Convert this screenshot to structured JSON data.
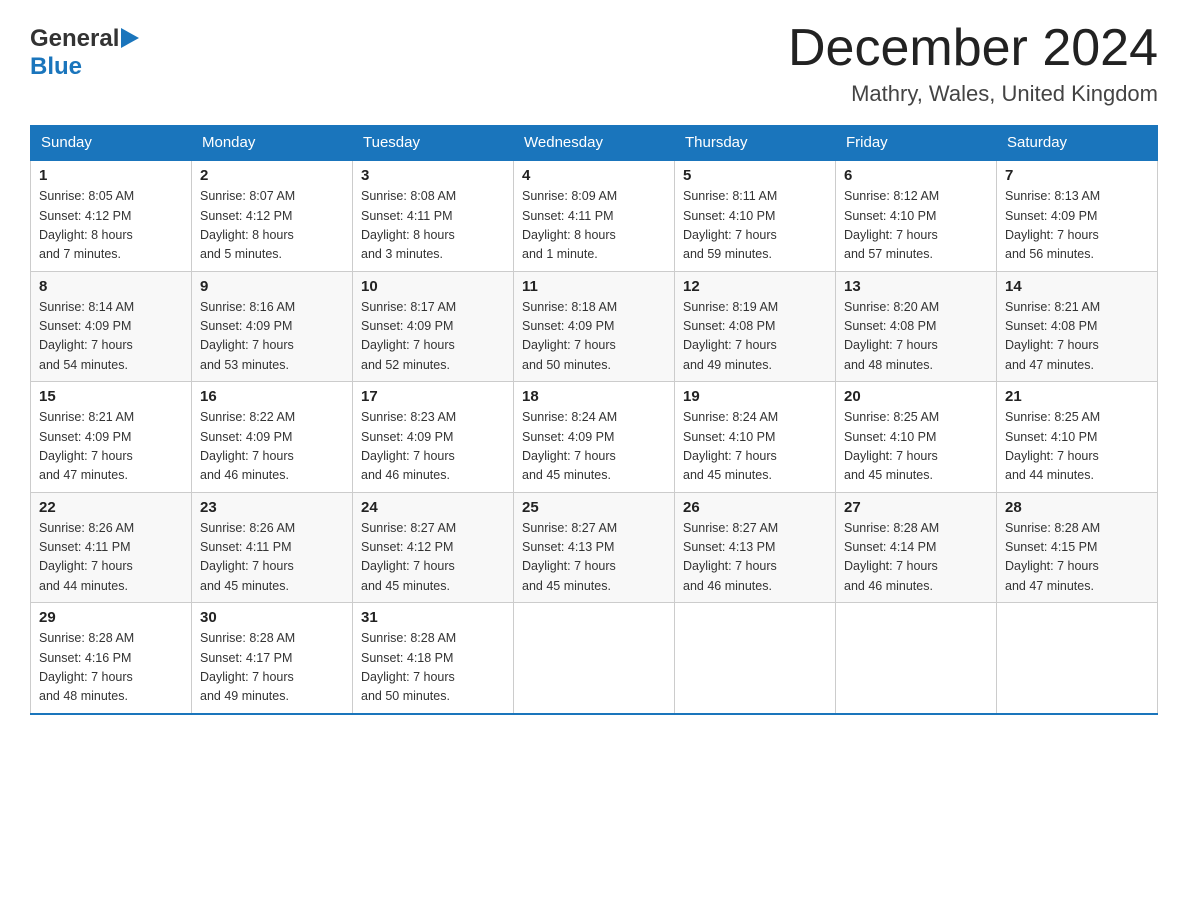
{
  "logo": {
    "line1": "General",
    "arrow_symbol": "▶",
    "line2": "Blue"
  },
  "title": {
    "month_year": "December 2024",
    "location": "Mathry, Wales, United Kingdom"
  },
  "weekdays": [
    "Sunday",
    "Monday",
    "Tuesday",
    "Wednesday",
    "Thursday",
    "Friday",
    "Saturday"
  ],
  "weeks": [
    [
      {
        "day": "1",
        "info": "Sunrise: 8:05 AM\nSunset: 4:12 PM\nDaylight: 8 hours\nand 7 minutes."
      },
      {
        "day": "2",
        "info": "Sunrise: 8:07 AM\nSunset: 4:12 PM\nDaylight: 8 hours\nand 5 minutes."
      },
      {
        "day": "3",
        "info": "Sunrise: 8:08 AM\nSunset: 4:11 PM\nDaylight: 8 hours\nand 3 minutes."
      },
      {
        "day": "4",
        "info": "Sunrise: 8:09 AM\nSunset: 4:11 PM\nDaylight: 8 hours\nand 1 minute."
      },
      {
        "day": "5",
        "info": "Sunrise: 8:11 AM\nSunset: 4:10 PM\nDaylight: 7 hours\nand 59 minutes."
      },
      {
        "day": "6",
        "info": "Sunrise: 8:12 AM\nSunset: 4:10 PM\nDaylight: 7 hours\nand 57 minutes."
      },
      {
        "day": "7",
        "info": "Sunrise: 8:13 AM\nSunset: 4:09 PM\nDaylight: 7 hours\nand 56 minutes."
      }
    ],
    [
      {
        "day": "8",
        "info": "Sunrise: 8:14 AM\nSunset: 4:09 PM\nDaylight: 7 hours\nand 54 minutes."
      },
      {
        "day": "9",
        "info": "Sunrise: 8:16 AM\nSunset: 4:09 PM\nDaylight: 7 hours\nand 53 minutes."
      },
      {
        "day": "10",
        "info": "Sunrise: 8:17 AM\nSunset: 4:09 PM\nDaylight: 7 hours\nand 52 minutes."
      },
      {
        "day": "11",
        "info": "Sunrise: 8:18 AM\nSunset: 4:09 PM\nDaylight: 7 hours\nand 50 minutes."
      },
      {
        "day": "12",
        "info": "Sunrise: 8:19 AM\nSunset: 4:08 PM\nDaylight: 7 hours\nand 49 minutes."
      },
      {
        "day": "13",
        "info": "Sunrise: 8:20 AM\nSunset: 4:08 PM\nDaylight: 7 hours\nand 48 minutes."
      },
      {
        "day": "14",
        "info": "Sunrise: 8:21 AM\nSunset: 4:08 PM\nDaylight: 7 hours\nand 47 minutes."
      }
    ],
    [
      {
        "day": "15",
        "info": "Sunrise: 8:21 AM\nSunset: 4:09 PM\nDaylight: 7 hours\nand 47 minutes."
      },
      {
        "day": "16",
        "info": "Sunrise: 8:22 AM\nSunset: 4:09 PM\nDaylight: 7 hours\nand 46 minutes."
      },
      {
        "day": "17",
        "info": "Sunrise: 8:23 AM\nSunset: 4:09 PM\nDaylight: 7 hours\nand 46 minutes."
      },
      {
        "day": "18",
        "info": "Sunrise: 8:24 AM\nSunset: 4:09 PM\nDaylight: 7 hours\nand 45 minutes."
      },
      {
        "day": "19",
        "info": "Sunrise: 8:24 AM\nSunset: 4:10 PM\nDaylight: 7 hours\nand 45 minutes."
      },
      {
        "day": "20",
        "info": "Sunrise: 8:25 AM\nSunset: 4:10 PM\nDaylight: 7 hours\nand 45 minutes."
      },
      {
        "day": "21",
        "info": "Sunrise: 8:25 AM\nSunset: 4:10 PM\nDaylight: 7 hours\nand 44 minutes."
      }
    ],
    [
      {
        "day": "22",
        "info": "Sunrise: 8:26 AM\nSunset: 4:11 PM\nDaylight: 7 hours\nand 44 minutes."
      },
      {
        "day": "23",
        "info": "Sunrise: 8:26 AM\nSunset: 4:11 PM\nDaylight: 7 hours\nand 45 minutes."
      },
      {
        "day": "24",
        "info": "Sunrise: 8:27 AM\nSunset: 4:12 PM\nDaylight: 7 hours\nand 45 minutes."
      },
      {
        "day": "25",
        "info": "Sunrise: 8:27 AM\nSunset: 4:13 PM\nDaylight: 7 hours\nand 45 minutes."
      },
      {
        "day": "26",
        "info": "Sunrise: 8:27 AM\nSunset: 4:13 PM\nDaylight: 7 hours\nand 46 minutes."
      },
      {
        "day": "27",
        "info": "Sunrise: 8:28 AM\nSunset: 4:14 PM\nDaylight: 7 hours\nand 46 minutes."
      },
      {
        "day": "28",
        "info": "Sunrise: 8:28 AM\nSunset: 4:15 PM\nDaylight: 7 hours\nand 47 minutes."
      }
    ],
    [
      {
        "day": "29",
        "info": "Sunrise: 8:28 AM\nSunset: 4:16 PM\nDaylight: 7 hours\nand 48 minutes."
      },
      {
        "day": "30",
        "info": "Sunrise: 8:28 AM\nSunset: 4:17 PM\nDaylight: 7 hours\nand 49 minutes."
      },
      {
        "day": "31",
        "info": "Sunrise: 8:28 AM\nSunset: 4:18 PM\nDaylight: 7 hours\nand 50 minutes."
      },
      {
        "day": "",
        "info": ""
      },
      {
        "day": "",
        "info": ""
      },
      {
        "day": "",
        "info": ""
      },
      {
        "day": "",
        "info": ""
      }
    ]
  ]
}
